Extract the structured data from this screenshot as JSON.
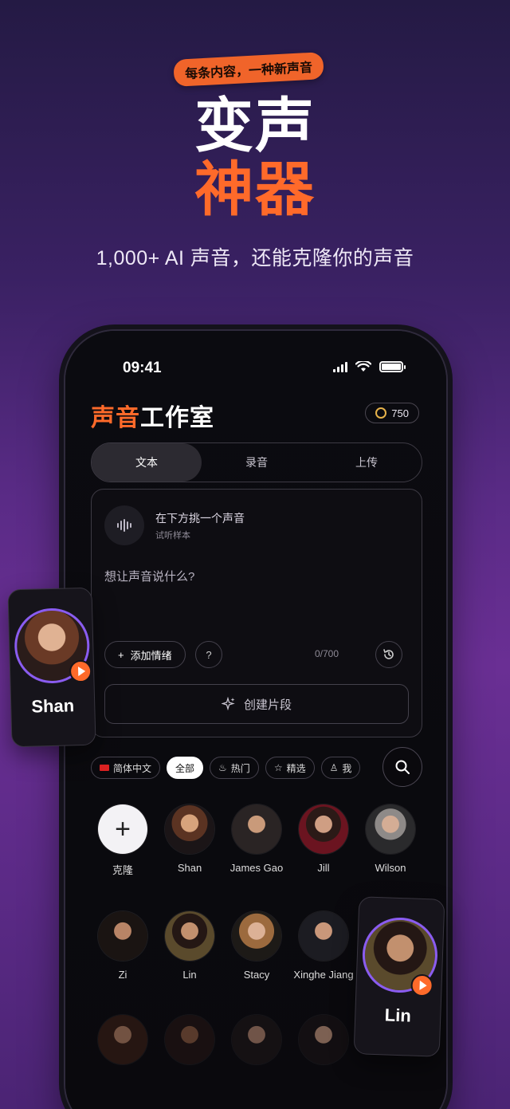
{
  "promo": {
    "tagline": "每条内容，一种新声音",
    "title_line1": "变声",
    "title_line2": "神器",
    "subtitle": "1,000+ AI 声音，还能克隆你的声音"
  },
  "status": {
    "time": "09:41"
  },
  "app": {
    "title_accent": "声音",
    "title_rest": "工作室",
    "credits": "750"
  },
  "tabs": [
    "文本",
    "录音",
    "上传"
  ],
  "editor": {
    "voice_title": "在下方挑一个声音",
    "voice_sub": "试听样本",
    "placeholder": "想让声音说什么?",
    "add_emotion": "添加情绪",
    "help": "?",
    "counter": "0/700",
    "create": "创建片段"
  },
  "filters": {
    "language": "简体中文",
    "all": "全部",
    "hot": "热门",
    "featured": "精选",
    "more": "我"
  },
  "voices": {
    "clone": "克隆",
    "v1": "Shan",
    "v2": "James Gao",
    "v3": "Jill",
    "v4": "Wilson",
    "v5": "Zi",
    "v6": "Lin",
    "v7": "Stacy",
    "v8": "Xinghe Jiang"
  },
  "floating": {
    "left": "Shan",
    "right": "Lin"
  },
  "colors": {
    "accent": "#ff6a2a",
    "ring": "#8a5cf0"
  }
}
